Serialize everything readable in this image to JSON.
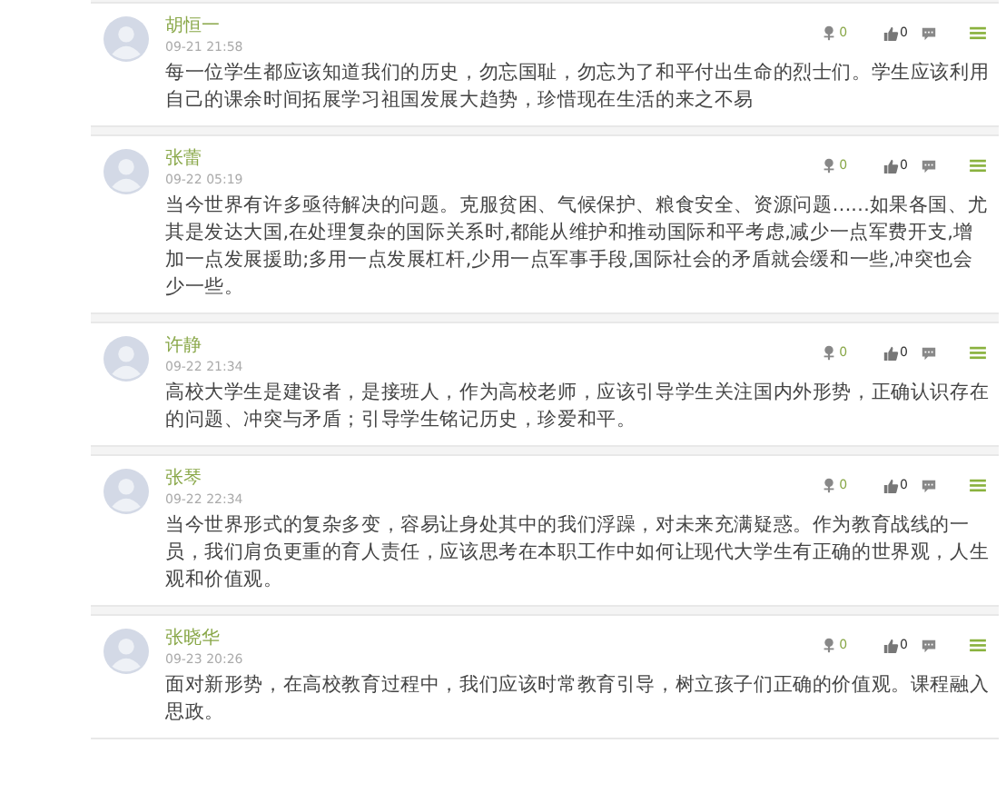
{
  "comments": [
    {
      "name": "胡恒一",
      "time": "09-21 21:58",
      "flowers": "0",
      "likes": "0",
      "text": "每一位学生都应该知道我们的历史，勿忘国耻，勿忘为了和平付出生命的烈士们。学生应该利用自己的课余时间拓展学习祖国发展大趋势，珍惜现在生活的来之不易"
    },
    {
      "name": "张蕾",
      "time": "09-22 05:19",
      "flowers": "0",
      "likes": "0",
      "text": "当今世界有许多亟待解决的问题。克服贫困、气候保护、粮食安全、资源问题……如果各国、尤其是发达大国,在处理复杂的国际关系时,都能从维护和推动国际和平考虑,减少一点军费开支,增加一点发展援助;多用一点发展杠杆,少用一点军事手段,国际社会的矛盾就会缓和一些,冲突也会少一些。"
    },
    {
      "name": "许静",
      "time": "09-22 21:34",
      "flowers": "0",
      "likes": "0",
      "text": "高校大学生是建设者，是接班人，作为高校老师，应该引导学生关注国内外形势，正确认识存在的问题、冲突与矛盾；引导学生铭记历史，珍爱和平。"
    },
    {
      "name": "张琴",
      "time": "09-22 22:34",
      "flowers": "0",
      "likes": "0",
      "text": "当今世界形式的复杂多变，容易让身处其中的我们浮躁，对未来充满疑惑。作为教育战线的一员，我们肩负更重的育人责任，应该思考在本职工作中如何让现代大学生有正确的世界观，人生观和价值观。"
    },
    {
      "name": "张晓华",
      "time": "09-23 20:26",
      "flowers": "0",
      "likes": "0",
      "text": "面对新形势，在高校教育过程中，我们应该时常教育引导，树立孩子们正确的价值观。课程融入思政。"
    }
  ]
}
